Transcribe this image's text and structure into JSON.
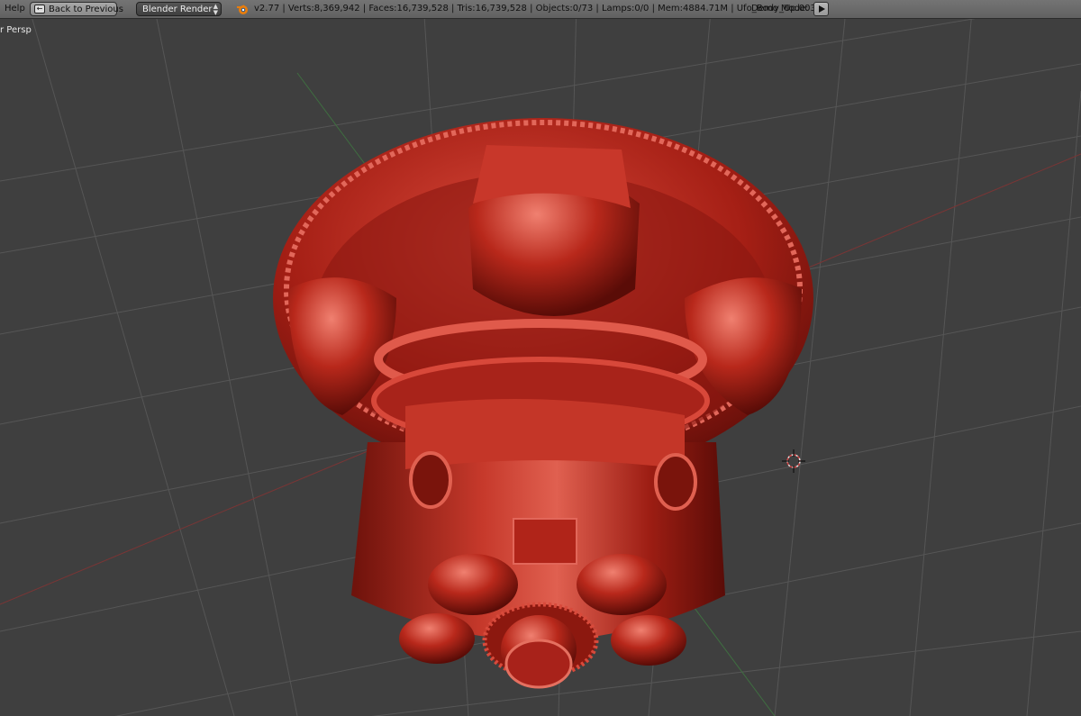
{
  "header": {
    "help_menu": "Help",
    "back_button_label": "Back to Previous",
    "render_engine": "Blender Render",
    "stats": "v2.77 | Verts:8,369,942 | Faces:16,739,528 | Tris:16,739,528 | Objects:0/73 | Lamps:0/0 | Mem:4884.71M | Ufo_Body_Up.003",
    "demo_mode_label": "Demo Mode:"
  },
  "viewport": {
    "view_label": "r Persp"
  },
  "icons": [
    "back-icon",
    "blender-logo-icon",
    "play-icon",
    "3d-cursor-icon"
  ],
  "colors": {
    "header": "#6b6b6b",
    "viewport": "#3f3f3f",
    "model": "#b8251a",
    "axis_x": "#8a3b3b",
    "axis_y": "#4f7a4f"
  }
}
